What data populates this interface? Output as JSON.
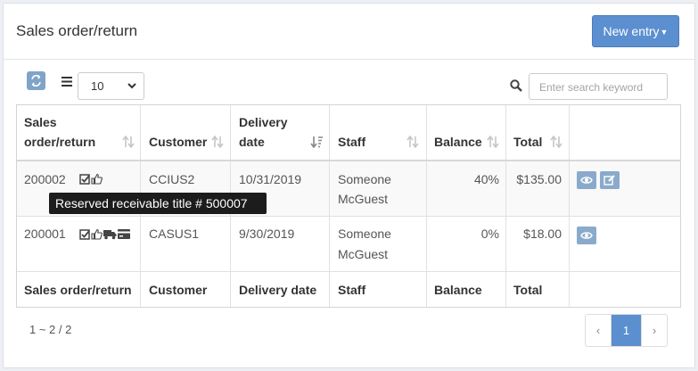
{
  "header": {
    "title": "Sales order/return",
    "new_entry_label": "New entry"
  },
  "toolbar": {
    "page_size": "10",
    "search_placeholder": "Enter search keyword"
  },
  "table": {
    "headers": [
      {
        "line1": "Sales",
        "line2": "order/return"
      },
      {
        "line1": "",
        "line2": "Customer"
      },
      {
        "line1": "Delivery",
        "line2": "date"
      },
      {
        "line1": "",
        "line2": "Staff"
      },
      {
        "line1": "",
        "line2": "Balance"
      },
      {
        "line1": "",
        "line2": "Total"
      }
    ],
    "rows": [
      {
        "order": "200002",
        "customer": "CCIUS2",
        "delivery_date": "10/31/2019",
        "staff_line1": "Someone",
        "staff_line2": "McGuest",
        "balance": "40%",
        "total": "$135.00",
        "status_icons": [
          "check-square-icon",
          "thumbs-up-icon"
        ]
      },
      {
        "order": "200001",
        "customer": "CASUS1",
        "delivery_date": "9/30/2019",
        "staff_line1": "Someone",
        "staff_line2": "McGuest",
        "balance": "0%",
        "total": "$18.00",
        "status_icons": [
          "check-square-icon",
          "thumbs-up-icon",
          "truck-icon",
          "credit-card-icon"
        ]
      }
    ],
    "footer": [
      "Sales order/return",
      "Customer",
      "Delivery date",
      "Staff",
      "Balance",
      "Total"
    ]
  },
  "tooltip": "Reserved receivable title # 500007",
  "pagination": {
    "info": "1 ~ 2 / 2",
    "prev": "‹",
    "current": "1",
    "next": "›"
  },
  "colors": {
    "primary": "#5b8fd0",
    "action_button": "#8aaacb"
  }
}
